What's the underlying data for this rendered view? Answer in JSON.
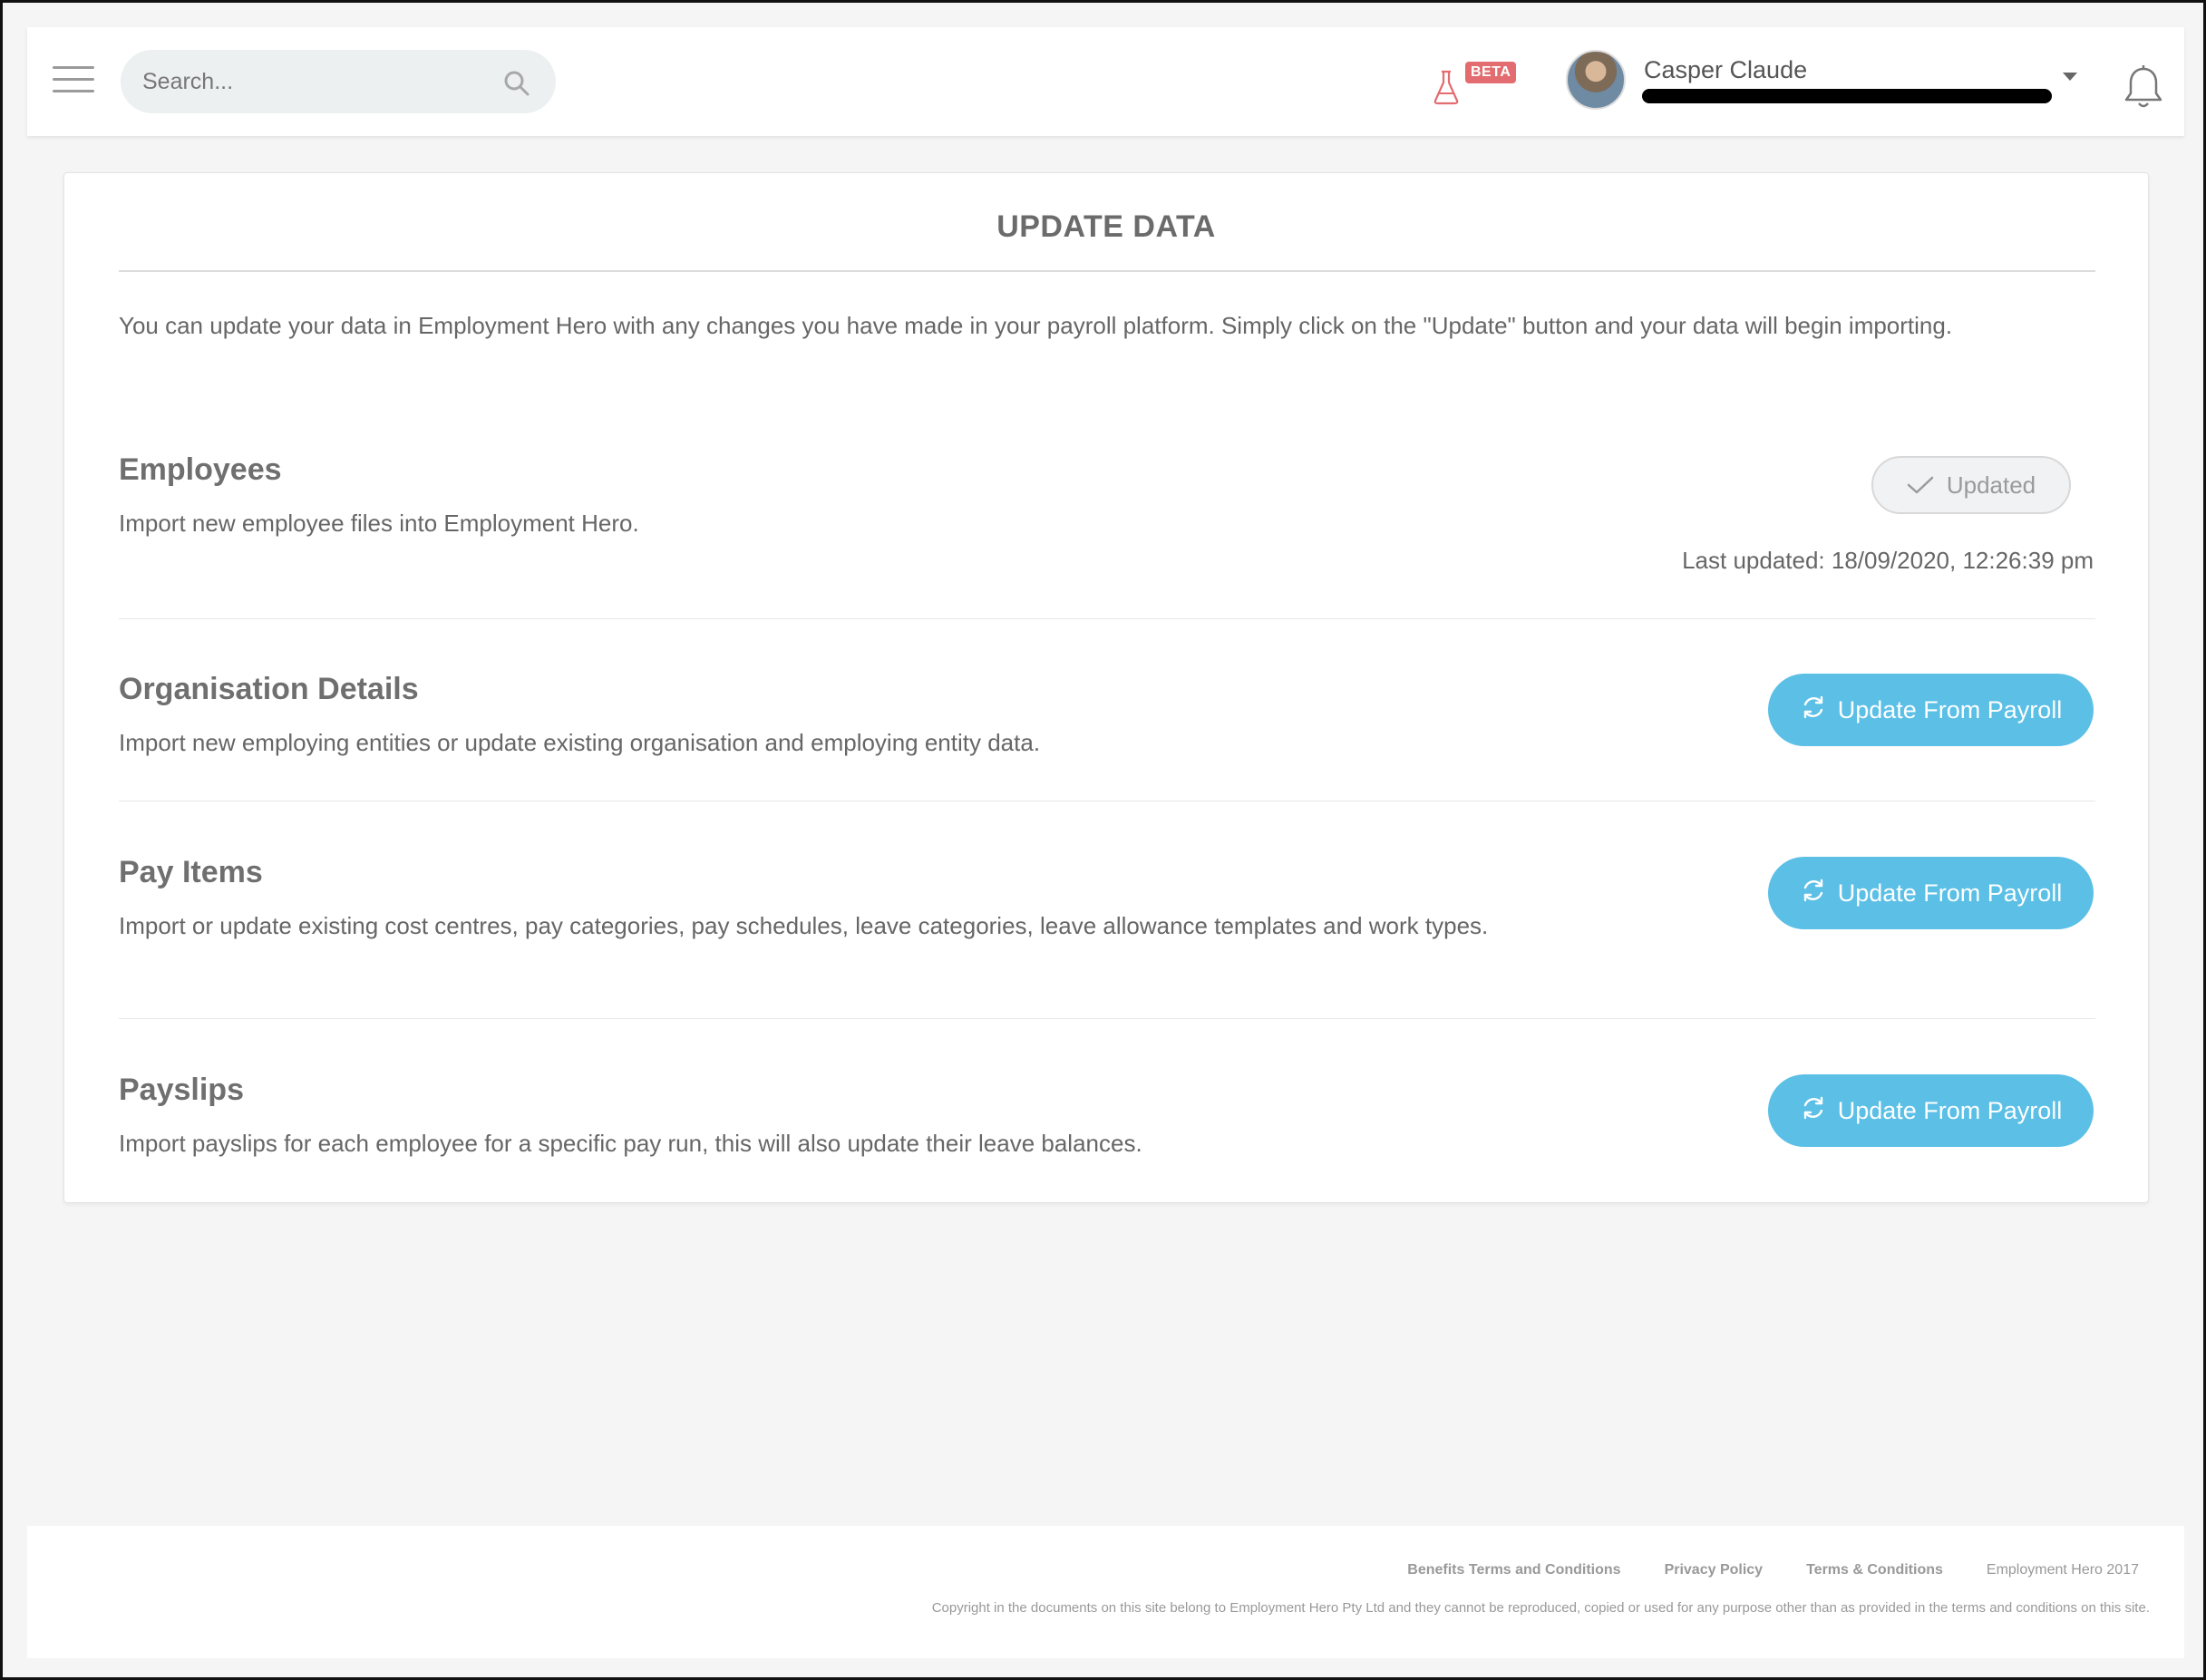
{
  "header": {
    "search_placeholder": "Search...",
    "beta_label": "BETA",
    "user_name": "Casper Claude",
    "icons": [
      "hamburger-menu-icon",
      "search-icon",
      "flask-icon",
      "chevron-down-icon",
      "bell-icon"
    ]
  },
  "page": {
    "title": "UPDATE DATA",
    "intro": "You can update your data in Employment Hero with any changes you have made in your payroll platform. Simply click on the \"Update\" button and your data will begin importing."
  },
  "sections": [
    {
      "title": "Employees",
      "description": "Import new employee files into Employment Hero.",
      "button_label": "Updated",
      "status": "Last updated: 18/09/2020, 12:26:39 pm"
    },
    {
      "title": "Organisation Details",
      "description": "Import new employing entities or update existing organisation and employing entity data.",
      "button_label": "Update From Payroll"
    },
    {
      "title": "Pay Items",
      "description": "Import or update existing cost centres, pay categories, pay schedules, leave categories, leave allowance templates and work types.",
      "button_label": "Update From Payroll"
    },
    {
      "title": "Payslips",
      "description": "Import payslips for each employee for a specific pay run, this will also update their leave balances.",
      "button_label": "Update From Payroll"
    }
  ],
  "footer": {
    "links": [
      "Benefits Terms and Conditions",
      "Privacy Policy",
      "Terms & Conditions"
    ],
    "brand": "Employment Hero 2017",
    "copyright": "Copyright in the documents on this site belong to Employment Hero Pty Ltd and they cannot be reproduced, copied or used for any purpose other than as provided in the terms and conditions on this site."
  },
  "colors": {
    "accent": "#5bbfe6",
    "beta_badge": "#e26c6f",
    "background": "#f5f5f5",
    "text": "#666666"
  }
}
